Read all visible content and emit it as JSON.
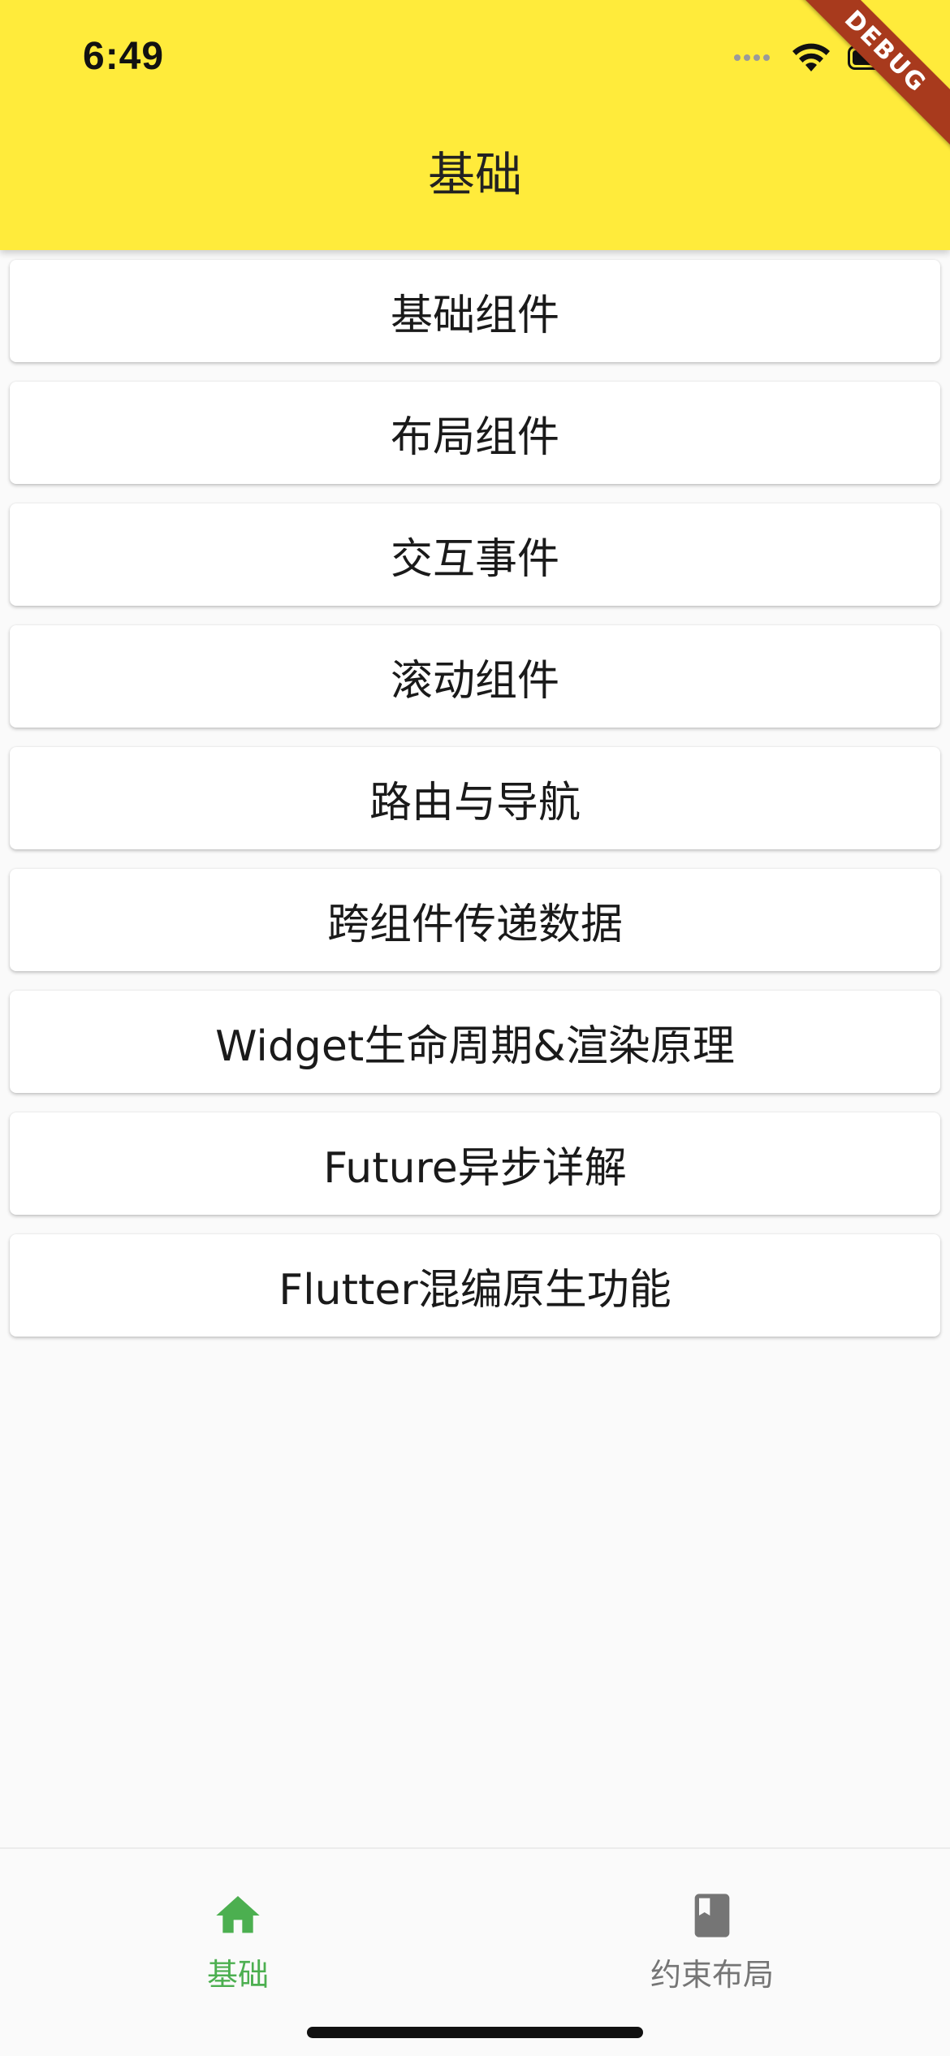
{
  "status_bar": {
    "time": "6:49"
  },
  "debug_banner": "DEBUG",
  "app_bar": {
    "title": "基础",
    "background": "#ffeb3b"
  },
  "list": {
    "items": [
      {
        "label": "基础组件"
      },
      {
        "label": "布局组件"
      },
      {
        "label": "交互事件"
      },
      {
        "label": "滚动组件"
      },
      {
        "label": "路由与导航"
      },
      {
        "label": "跨组件传递数据"
      },
      {
        "label": "Widget生命周期&渲染原理"
      },
      {
        "label": "Future异步详解"
      },
      {
        "label": "Flutter混编原生功能"
      }
    ]
  },
  "bottom_nav": {
    "active_color": "#4caf50",
    "inactive_color": "#757575",
    "items": [
      {
        "label": "基础",
        "icon": "home-icon",
        "active": true
      },
      {
        "label": "约束布局",
        "icon": "book-icon",
        "active": false
      }
    ]
  }
}
